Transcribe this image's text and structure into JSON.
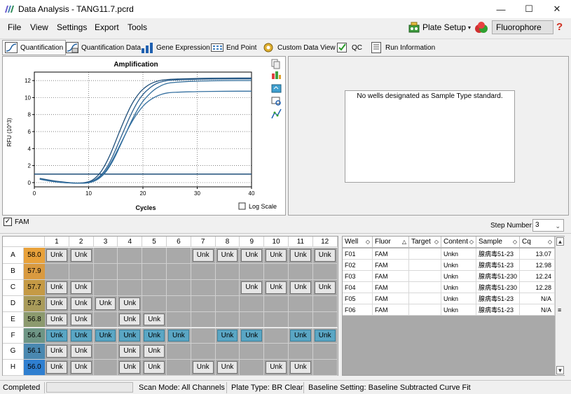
{
  "window": {
    "title": "Data Analysis - TANG11.7.pcrd",
    "minimize": "—",
    "maximize": "☐",
    "close": "✕"
  },
  "menu": {
    "file": "File",
    "view": "View",
    "settings": "Settings",
    "export": "Export",
    "tools": "Tools"
  },
  "header_buttons": {
    "plate_setup": "Plate Setup",
    "fluorophore": "Fluorophore",
    "help": "?"
  },
  "tabs": [
    {
      "label": "Quantification",
      "icon": "quantification-icon"
    },
    {
      "label": "Quantification Data",
      "icon": "quantification-data-icon"
    },
    {
      "label": "Gene Expression",
      "icon": "gene-expression-icon"
    },
    {
      "label": "End Point",
      "icon": "end-point-icon"
    },
    {
      "label": "Custom Data View",
      "icon": "custom-data-view-icon"
    },
    {
      "label": "QC",
      "icon": "qc-icon"
    },
    {
      "label": "Run Information",
      "icon": "run-information-icon"
    }
  ],
  "chart_data": {
    "type": "line",
    "title": "Amplification",
    "xlabel": "Cycles",
    "ylabel": "RFU (10^3)",
    "xlim": [
      0,
      40
    ],
    "ylim": [
      -0.5,
      13
    ],
    "xticks": [
      0,
      10,
      20,
      30,
      40
    ],
    "yticks": [
      0,
      2,
      4,
      6,
      8,
      10,
      12
    ],
    "grid": true,
    "log_scale_label": "Log Scale",
    "log_scale": false,
    "threshold": 1.0,
    "series": [
      {
        "x": [
          1,
          4,
          8,
          10,
          11,
          12,
          13,
          14,
          15,
          16,
          17,
          18,
          19,
          20,
          21,
          22,
          23,
          24,
          25,
          27,
          30,
          35,
          40
        ],
        "values": [
          0.5,
          0.15,
          -0.1,
          0.05,
          0.4,
          1.0,
          2.0,
          3.3,
          4.9,
          6.5,
          8.0,
          9.3,
          10.3,
          11.0,
          11.5,
          11.8,
          12.0,
          12.1,
          12.15,
          12.2,
          12.25,
          12.3,
          12.3
        ]
      },
      {
        "x": [
          1,
          4,
          8,
          10,
          11,
          12,
          13,
          14,
          15,
          16,
          17,
          18,
          19,
          20,
          21,
          22,
          23,
          24,
          25,
          27,
          30,
          35,
          40
        ],
        "values": [
          0.45,
          0.1,
          -0.1,
          0.0,
          0.25,
          0.7,
          1.4,
          2.5,
          3.9,
          5.4,
          6.9,
          8.3,
          9.5,
          10.4,
          11.0,
          11.5,
          11.8,
          11.95,
          12.05,
          12.1,
          12.15,
          12.2,
          12.2
        ]
      },
      {
        "x": [
          1,
          4,
          8,
          10,
          11,
          12,
          13,
          14,
          15,
          16,
          17,
          18,
          19,
          20,
          21,
          22,
          23,
          24,
          25,
          27,
          30,
          35,
          40
        ],
        "values": [
          0.4,
          0.05,
          -0.1,
          -0.05,
          0.15,
          0.5,
          1.1,
          2.0,
          3.2,
          4.6,
          6.0,
          7.4,
          8.6,
          9.6,
          10.3,
          10.9,
          11.3,
          11.6,
          11.75,
          11.85,
          11.95,
          12.0,
          12.0
        ]
      },
      {
        "x": [
          1,
          4,
          8,
          10,
          11,
          12,
          13,
          14,
          15,
          16,
          17,
          18,
          19,
          20,
          21,
          22,
          23,
          24,
          25,
          27,
          30,
          35,
          40
        ],
        "values": [
          0.4,
          0.05,
          -0.1,
          -0.05,
          0.2,
          0.6,
          1.2,
          2.2,
          3.4,
          4.7,
          6.0,
          7.2,
          8.2,
          9.0,
          9.6,
          10.0,
          10.3,
          10.5,
          10.6,
          10.65,
          10.7,
          10.75,
          10.75
        ]
      }
    ]
  },
  "std_message": "No wells designated as Sample Type standard.",
  "fluor_toggle": {
    "label": "FAM",
    "checked": true
  },
  "step": {
    "label": "Step Number:",
    "value": "3"
  },
  "plate": {
    "columns": [
      "1",
      "2",
      "3",
      "4",
      "5",
      "6",
      "7",
      "8",
      "9",
      "10",
      "11",
      "12"
    ],
    "rows": [
      {
        "label": "A",
        "temp": "58.0",
        "color": "#e8a13a",
        "wells": [
          "Unk",
          "Unk",
          "",
          "",
          "",
          "",
          "Unk",
          "Unk",
          "Unk",
          "Unk",
          "Unk",
          "Unk"
        ]
      },
      {
        "label": "B",
        "temp": "57.9",
        "color": "#d99a40",
        "wells": [
          "",
          "",
          "",
          "",
          "",
          "",
          "",
          "",
          "",
          "",
          "",
          ""
        ]
      },
      {
        "label": "C",
        "temp": "57.7",
        "color": "#c59a45",
        "wells": [
          "Unk",
          "Unk",
          "",
          "",
          "",
          "",
          "",
          "",
          "Unk",
          "Unk",
          "Unk",
          "Unk"
        ]
      },
      {
        "label": "D",
        "temp": "57.3",
        "color": "#a99b5a",
        "wells": [
          "Unk",
          "Unk",
          "Unk",
          "Unk",
          "",
          "",
          "",
          "",
          "",
          "",
          "",
          ""
        ]
      },
      {
        "label": "E",
        "temp": "56.8",
        "color": "#8c9a6e",
        "wells": [
          "Unk",
          "Unk",
          "",
          "Unk",
          "Unk",
          "",
          "",
          "",
          "",
          "",
          "",
          ""
        ]
      },
      {
        "label": "F",
        "temp": "56.4",
        "color": "#6e9585",
        "wells": [
          "Unk",
          "Unk",
          "Unk",
          "Unk",
          "Unk",
          "Unk",
          "",
          "Unk",
          "Unk",
          "",
          "Unk",
          "Unk"
        ]
      },
      {
        "label": "G",
        "temp": "56.1",
        "color": "#4a88b0",
        "wells": [
          "Unk",
          "Unk",
          "",
          "Unk",
          "Unk",
          "",
          "",
          "",
          "",
          "",
          "",
          ""
        ]
      },
      {
        "label": "H",
        "temp": "56.0",
        "color": "#2f7fd0",
        "wells": [
          "Unk",
          "Unk",
          "",
          "Unk",
          "Unk",
          "",
          "Unk",
          "Unk",
          "",
          "Unk",
          "Unk",
          ""
        ]
      }
    ],
    "selected_row": "F"
  },
  "results": {
    "headers": [
      "Well",
      "Fluor",
      "Target",
      "Content",
      "Sample",
      "Cq"
    ],
    "rows": [
      [
        "F01",
        "FAM",
        "",
        "Unkn",
        "腺病毒51-23",
        "13.07"
      ],
      [
        "F02",
        "FAM",
        "",
        "Unkn",
        "腺病毒51-23",
        "12.98"
      ],
      [
        "F03",
        "FAM",
        "",
        "Unkn",
        "腺病毒51-230",
        "12.24"
      ],
      [
        "F04",
        "FAM",
        "",
        "Unkn",
        "腺病毒51-230",
        "12.28"
      ],
      [
        "F05",
        "FAM",
        "",
        "Unkn",
        "腺病毒51-23",
        "N/A"
      ],
      [
        "F06",
        "FAM",
        "",
        "Unkn",
        "腺病毒51-23",
        "N/A"
      ]
    ]
  },
  "status": {
    "state": "Completed",
    "scan_mode": "Scan Mode: All Channels",
    "plate_type": "Plate Type: BR Clear",
    "baseline": "Baseline Setting: Baseline Subtracted Curve Fit"
  }
}
